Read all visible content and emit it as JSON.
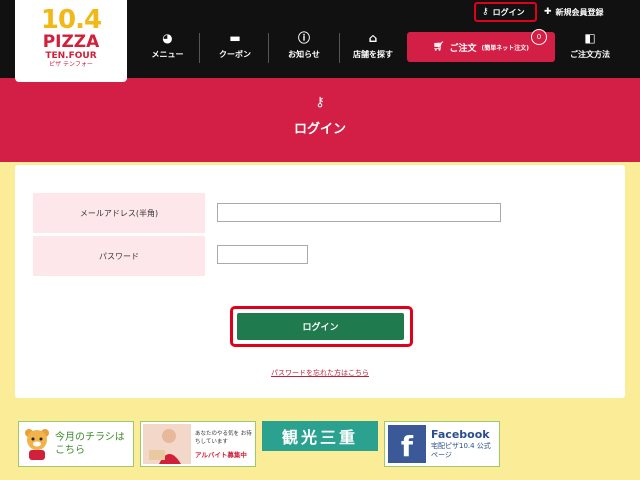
{
  "logo": {
    "number": "10.4",
    "pizza": "PIZZA",
    "tenfour": "TEN.FOUR",
    "kana": "ピザ テンフォー"
  },
  "top_links": {
    "login": "ログイン",
    "register": "新規会員登録"
  },
  "nav": [
    {
      "label": "メニュー",
      "icon": "pizza-icon"
    },
    {
      "label": "クーポン",
      "icon": "coupon-icon"
    },
    {
      "label": "お知らせ",
      "icon": "info-icon"
    },
    {
      "label": "店舗を探す",
      "icon": "store-icon"
    }
  ],
  "order": {
    "label": "ご注文",
    "sub": "(簡単ネット注文)",
    "badge": "0",
    "icon": "cart-icon"
  },
  "how_to_order": {
    "label": "ご注文方法",
    "icon": "book-icon"
  },
  "banner": {
    "title": "ログイン",
    "icon": "key-icon"
  },
  "form": {
    "email_label": "メールアドレス(半角)",
    "email_value": "",
    "password_label": "パスワード",
    "password_value": "",
    "submit": "ログイン",
    "forgot": "パスワードを忘れた方はこちら"
  },
  "promos": {
    "flyer": "今月のチラシは こちら",
    "job_line1": "あなたのやる気を お待ちしています",
    "job_line2": "アルバイト募集中",
    "tourism": "観光三重",
    "fb_title": "Facebook",
    "fb_sub": "宅配ピザ10.4 公式ページ"
  },
  "colors": {
    "header": "#111111",
    "brand_red": "#d31f45",
    "login_green": "#1f7a4d",
    "page_yellow": "#fbed98",
    "logo_yellow": "#f2b817"
  }
}
